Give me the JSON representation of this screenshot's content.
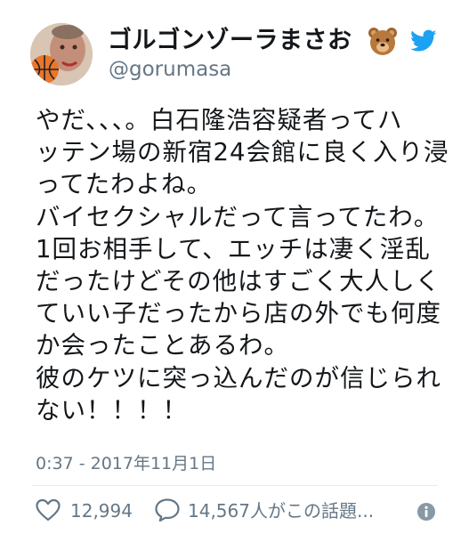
{
  "user": {
    "display_name": "ゴルゴンゾーラまさお",
    "handle": "@gorumasa",
    "name_emoji": "bear-face-icon",
    "platform_icon": "bird-icon"
  },
  "tweet": {
    "lines": [
      "やだ、、、。白石隆浩容疑者ってハ",
      "ッテン場の新宿24会館に良く入り浸",
      "ってたわよね。",
      "バイセクシャルだって言ってたわ。",
      "1回お相手して、エッチは凄く淫乱",
      "だったけどその他はすごく大人しく",
      "ていい子だったから店の外でも何度",
      "か会ったことあるわ。",
      "彼のケツに突っ込んだのが信じられ",
      "ない！！！！"
    ],
    "timestamp": "0:37 - 2017年11月1日"
  },
  "actions": {
    "like_count": "12,994",
    "reply_text": "14,567人がこの話題...",
    "like_icon": "heart-icon",
    "reply_icon": "reply-bubble-icon",
    "info_icon": "info-icon"
  },
  "colors": {
    "brand_blue": "#1da1f2",
    "text_primary": "#14171a",
    "text_secondary": "#657786",
    "divider": "#e6ecf0"
  }
}
